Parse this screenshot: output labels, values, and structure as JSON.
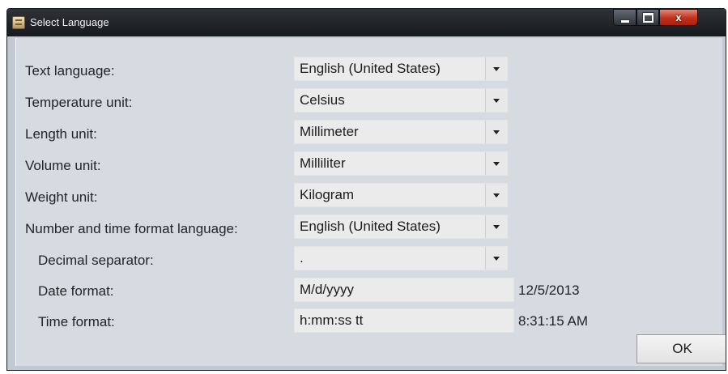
{
  "window": {
    "title": "Select Language",
    "minimize_glyph": "",
    "maximize_glyph": "",
    "close_glyph": "x",
    "title_icon": "app-icon"
  },
  "form": {
    "rows": [
      {
        "label": "Text language:",
        "value": "English (United States)",
        "type": "dropdown"
      },
      {
        "label": "Temperature unit:",
        "value": "Celsius",
        "type": "dropdown"
      },
      {
        "label": "Length unit:",
        "value": "Millimeter",
        "type": "dropdown"
      },
      {
        "label": "Volume unit:",
        "value": "Milliliter",
        "type": "dropdown"
      },
      {
        "label": "Weight unit:",
        "value": "Kilogram",
        "type": "dropdown"
      },
      {
        "label": "Number and time format language:",
        "value": "English (United States)",
        "type": "dropdown"
      },
      {
        "label": "Decimal separator:",
        "value": ".",
        "type": "dropdown"
      },
      {
        "label": "Date format:",
        "value": "M/d/yyyy",
        "type": "text",
        "preview": "12/5/2013"
      },
      {
        "label": "Time format:",
        "value": "h:mm:ss tt",
        "type": "text",
        "preview": "8:31:15 AM"
      }
    ]
  },
  "ok_label": "OK"
}
